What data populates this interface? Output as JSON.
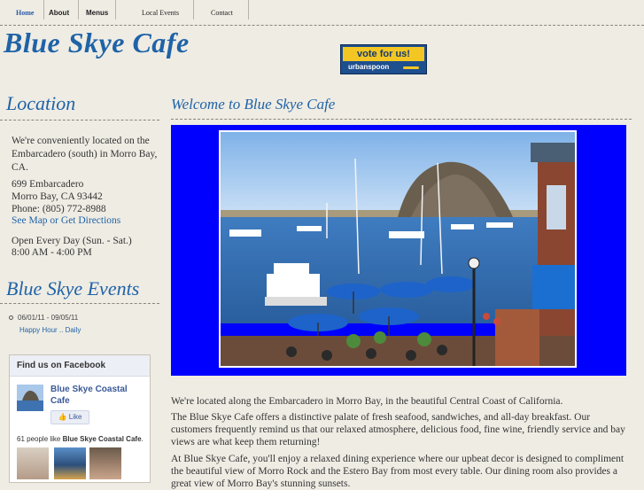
{
  "nav": {
    "items": [
      {
        "label": "Home"
      },
      {
        "label": "About"
      },
      {
        "label": "Menus"
      },
      {
        "label": "Local Events"
      },
      {
        "label": "Contact"
      }
    ]
  },
  "header": {
    "title": "Blue Skye Cafe",
    "vote_badge": {
      "top": "vote for us!",
      "bottom": "urbanspoon"
    }
  },
  "sidebar": {
    "location_title": "Location",
    "location_intro": "We're conveniently located on the Embarcadero (south) in Morro Bay, CA.",
    "address_line1": "699 Embarcadero",
    "address_line2": "Morro Bay, CA 93442",
    "phone": "Phone: (805) 772-8988",
    "map_link": "See Map or Get Directions",
    "hours_line1": "Open Every Day (Sun. - Sat.)",
    "hours_line2": "8:00 AM - 4:00 PM",
    "events_title": "Blue Skye Events",
    "event": {
      "date": "06/01/11 - 09/05/11",
      "title": "Happy Hour .. Daily"
    },
    "facebook": {
      "header": "Find us on Facebook",
      "page_name": "Blue Skye Coastal Cafe",
      "like_label": "Like",
      "count_prefix": "61 people like ",
      "count_name": "Blue Skye Coastal Cafe",
      "count_suffix": "."
    }
  },
  "main": {
    "welcome_title": "Welcome to Blue Skye Cafe",
    "paragraph1": "We're located along the Embarcadero in Morro Bay, in the beautiful Central Coast of California.",
    "paragraph2": "The Blue Skye Cafe offers a distinctive palate of fresh seafood, sandwiches, and all-day breakfast. Our customers frequently remind us that our relaxed atmosphere, delicious food, fine wine, friendly service and bay views are what keep them returning!",
    "paragraph3": "At Blue Skye Cafe, you'll enjoy a relaxed dining experience where our upbeat decor is designed to compliment the beautiful view of Morro Rock and the Estero Bay from most every table. Our dining room also provides a great view of Morro Bay's stunning sunsets."
  },
  "colors": {
    "accent": "#1f63a7",
    "photo_frame": "#0000ff",
    "background": "#efece4"
  }
}
